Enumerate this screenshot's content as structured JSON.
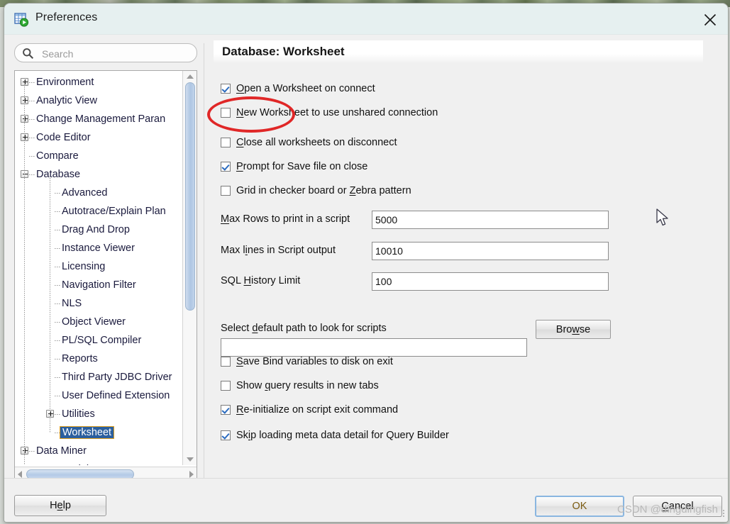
{
  "window": {
    "title": "Preferences",
    "icon": "worksheet-run-icon",
    "close_label": "✕"
  },
  "sidebar": {
    "search": {
      "placeholder": "Search",
      "value": "",
      "icon": "search-icon"
    },
    "tree": [
      {
        "label": "Environment",
        "depth": 0,
        "toggle": "plus",
        "selected": false
      },
      {
        "label": "Analytic View",
        "depth": 0,
        "toggle": "plus",
        "selected": false
      },
      {
        "label": "Change Management Paran",
        "depth": 0,
        "toggle": "plus",
        "selected": false
      },
      {
        "label": "Code Editor",
        "depth": 0,
        "toggle": "plus",
        "selected": false
      },
      {
        "label": "Compare",
        "depth": 0,
        "toggle": "none",
        "selected": false
      },
      {
        "label": "Database",
        "depth": 0,
        "toggle": "minus",
        "selected": false
      },
      {
        "label": "Advanced",
        "depth": 1,
        "toggle": "none",
        "selected": false
      },
      {
        "label": "Autotrace/Explain Plan",
        "depth": 1,
        "toggle": "none",
        "selected": false
      },
      {
        "label": "Drag And Drop",
        "depth": 1,
        "toggle": "none",
        "selected": false
      },
      {
        "label": "Instance Viewer",
        "depth": 1,
        "toggle": "none",
        "selected": false
      },
      {
        "label": "Licensing",
        "depth": 1,
        "toggle": "none",
        "selected": false
      },
      {
        "label": "Navigation Filter",
        "depth": 1,
        "toggle": "none",
        "selected": false
      },
      {
        "label": "NLS",
        "depth": 1,
        "toggle": "none",
        "selected": false
      },
      {
        "label": "Object Viewer",
        "depth": 1,
        "toggle": "none",
        "selected": false
      },
      {
        "label": "PL/SQL Compiler",
        "depth": 1,
        "toggle": "none",
        "selected": false
      },
      {
        "label": "Reports",
        "depth": 1,
        "toggle": "none",
        "selected": false
      },
      {
        "label": "Third Party JDBC Driver",
        "depth": 1,
        "toggle": "none",
        "selected": false
      },
      {
        "label": "User Defined Extension",
        "depth": 1,
        "toggle": "none",
        "selected": false
      },
      {
        "label": "Utilities",
        "depth": 1,
        "toggle": "plus",
        "selected": false
      },
      {
        "label": "Worksheet",
        "depth": 1,
        "toggle": "none",
        "selected": true
      },
      {
        "label": "Data Miner",
        "depth": 0,
        "toggle": "plus",
        "selected": false
      },
      {
        "label": "Data Modeler",
        "depth": 0,
        "toggle": "plus",
        "selected": false
      }
    ]
  },
  "panel": {
    "title": "Database: Worksheet",
    "checkboxes_top": [
      {
        "label_pre": "",
        "mnemonic": "O",
        "label_post": "pen a Worksheet on connect",
        "checked": true
      },
      {
        "label_pre": "",
        "mnemonic": "N",
        "label_post": "ew Worksheet to use unshared connection",
        "checked": false
      },
      {
        "label_pre": "",
        "mnemonic": "C",
        "label_post": "lose all worksheets on disconnect",
        "checked": false
      },
      {
        "label_pre": "",
        "mnemonic": "P",
        "label_post": "rompt for Save file on close",
        "checked": true
      },
      {
        "label_pre": "Grid in checker board or ",
        "mnemonic": "Z",
        "label_post": "ebra pattern",
        "checked": false
      }
    ],
    "fields": [
      {
        "label_pre": "",
        "mnemonic": "M",
        "label_post": "ax Rows to print in a script",
        "value": "5000"
      },
      {
        "label_pre": "Max l",
        "mnemonic": "i",
        "label_post": "nes in Script output",
        "value": "10010"
      },
      {
        "label_pre": "SQL ",
        "mnemonic": "H",
        "label_post": "istory Limit",
        "value": "100"
      }
    ],
    "path_label_pre": "Select ",
    "path_label_mnemonic": "d",
    "path_label_post": "efault path to look for scripts",
    "path_value": "",
    "browse_pre": "Bro",
    "browse_mn": "w",
    "browse_post": "se",
    "checkboxes_bottom": [
      {
        "label_pre": "",
        "mnemonic": "S",
        "label_post": "ave Bind variables to disk on exit",
        "checked": false
      },
      {
        "label_pre": "Show ",
        "mnemonic": "q",
        "label_post": "uery results in new tabs",
        "checked": false
      },
      {
        "label_pre": "",
        "mnemonic": "R",
        "label_post": "e-initialize on script exit command",
        "checked": true
      },
      {
        "label_pre": "Sk",
        "mnemonic": "i",
        "label_post": "p loading meta data detail for Query Builder",
        "checked": true
      }
    ]
  },
  "footer": {
    "help_pre": "H",
    "help_mn": "e",
    "help_post": "lp",
    "ok_label": "OK",
    "cancel_pre": "",
    "cancel_mn": "C",
    "cancel_post": "ancel"
  },
  "overlay": {
    "watermark": "CSDN @dingdingfish",
    "annotation_color": "#e02727"
  }
}
